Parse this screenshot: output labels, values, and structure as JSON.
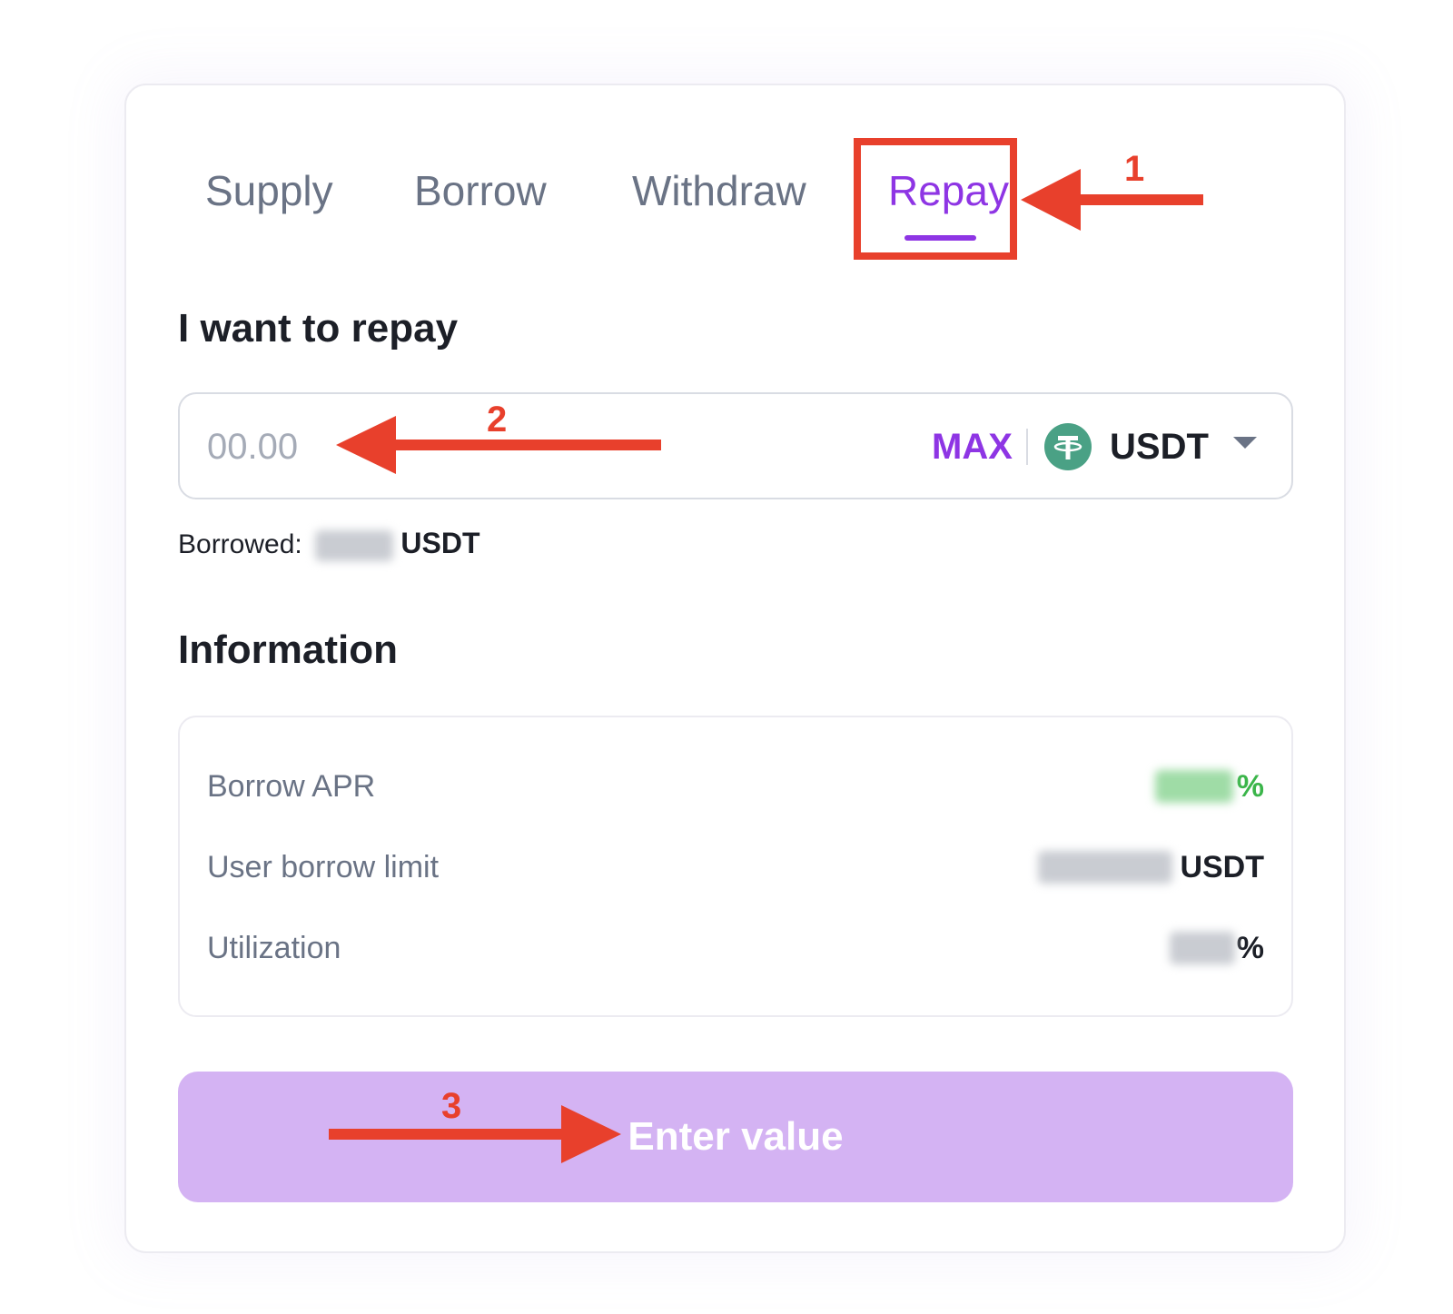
{
  "tabs": [
    {
      "label": "Supply",
      "active": false
    },
    {
      "label": "Borrow",
      "active": false
    },
    {
      "label": "Withdraw",
      "active": false
    },
    {
      "label": "Repay",
      "active": true
    }
  ],
  "repay": {
    "heading": "I want to repay",
    "amount_placeholder": "00.00",
    "amount_value": "",
    "max_label": "MAX",
    "token": "USDT",
    "borrowed_label": "Borrowed:",
    "borrowed_unit": "USDT"
  },
  "information": {
    "heading": "Information",
    "rows": [
      {
        "label": "Borrow APR",
        "suffix": "%"
      },
      {
        "label": "User borrow limit",
        "suffix": "USDT"
      },
      {
        "label": "Utilization",
        "suffix": "%"
      }
    ]
  },
  "submit": {
    "label": "Enter value"
  },
  "annotations": {
    "step1": "1",
    "step2": "2",
    "step3": "3"
  },
  "colors": {
    "accent": "#8e35e4",
    "button_disabled": "#d4b3f3",
    "annotation": "#e8402c",
    "positive": "#3bb54a",
    "usdt_icon": "#4aa185"
  },
  "icons": {
    "token": "tether-icon",
    "dropdown": "chevron-down-icon"
  }
}
